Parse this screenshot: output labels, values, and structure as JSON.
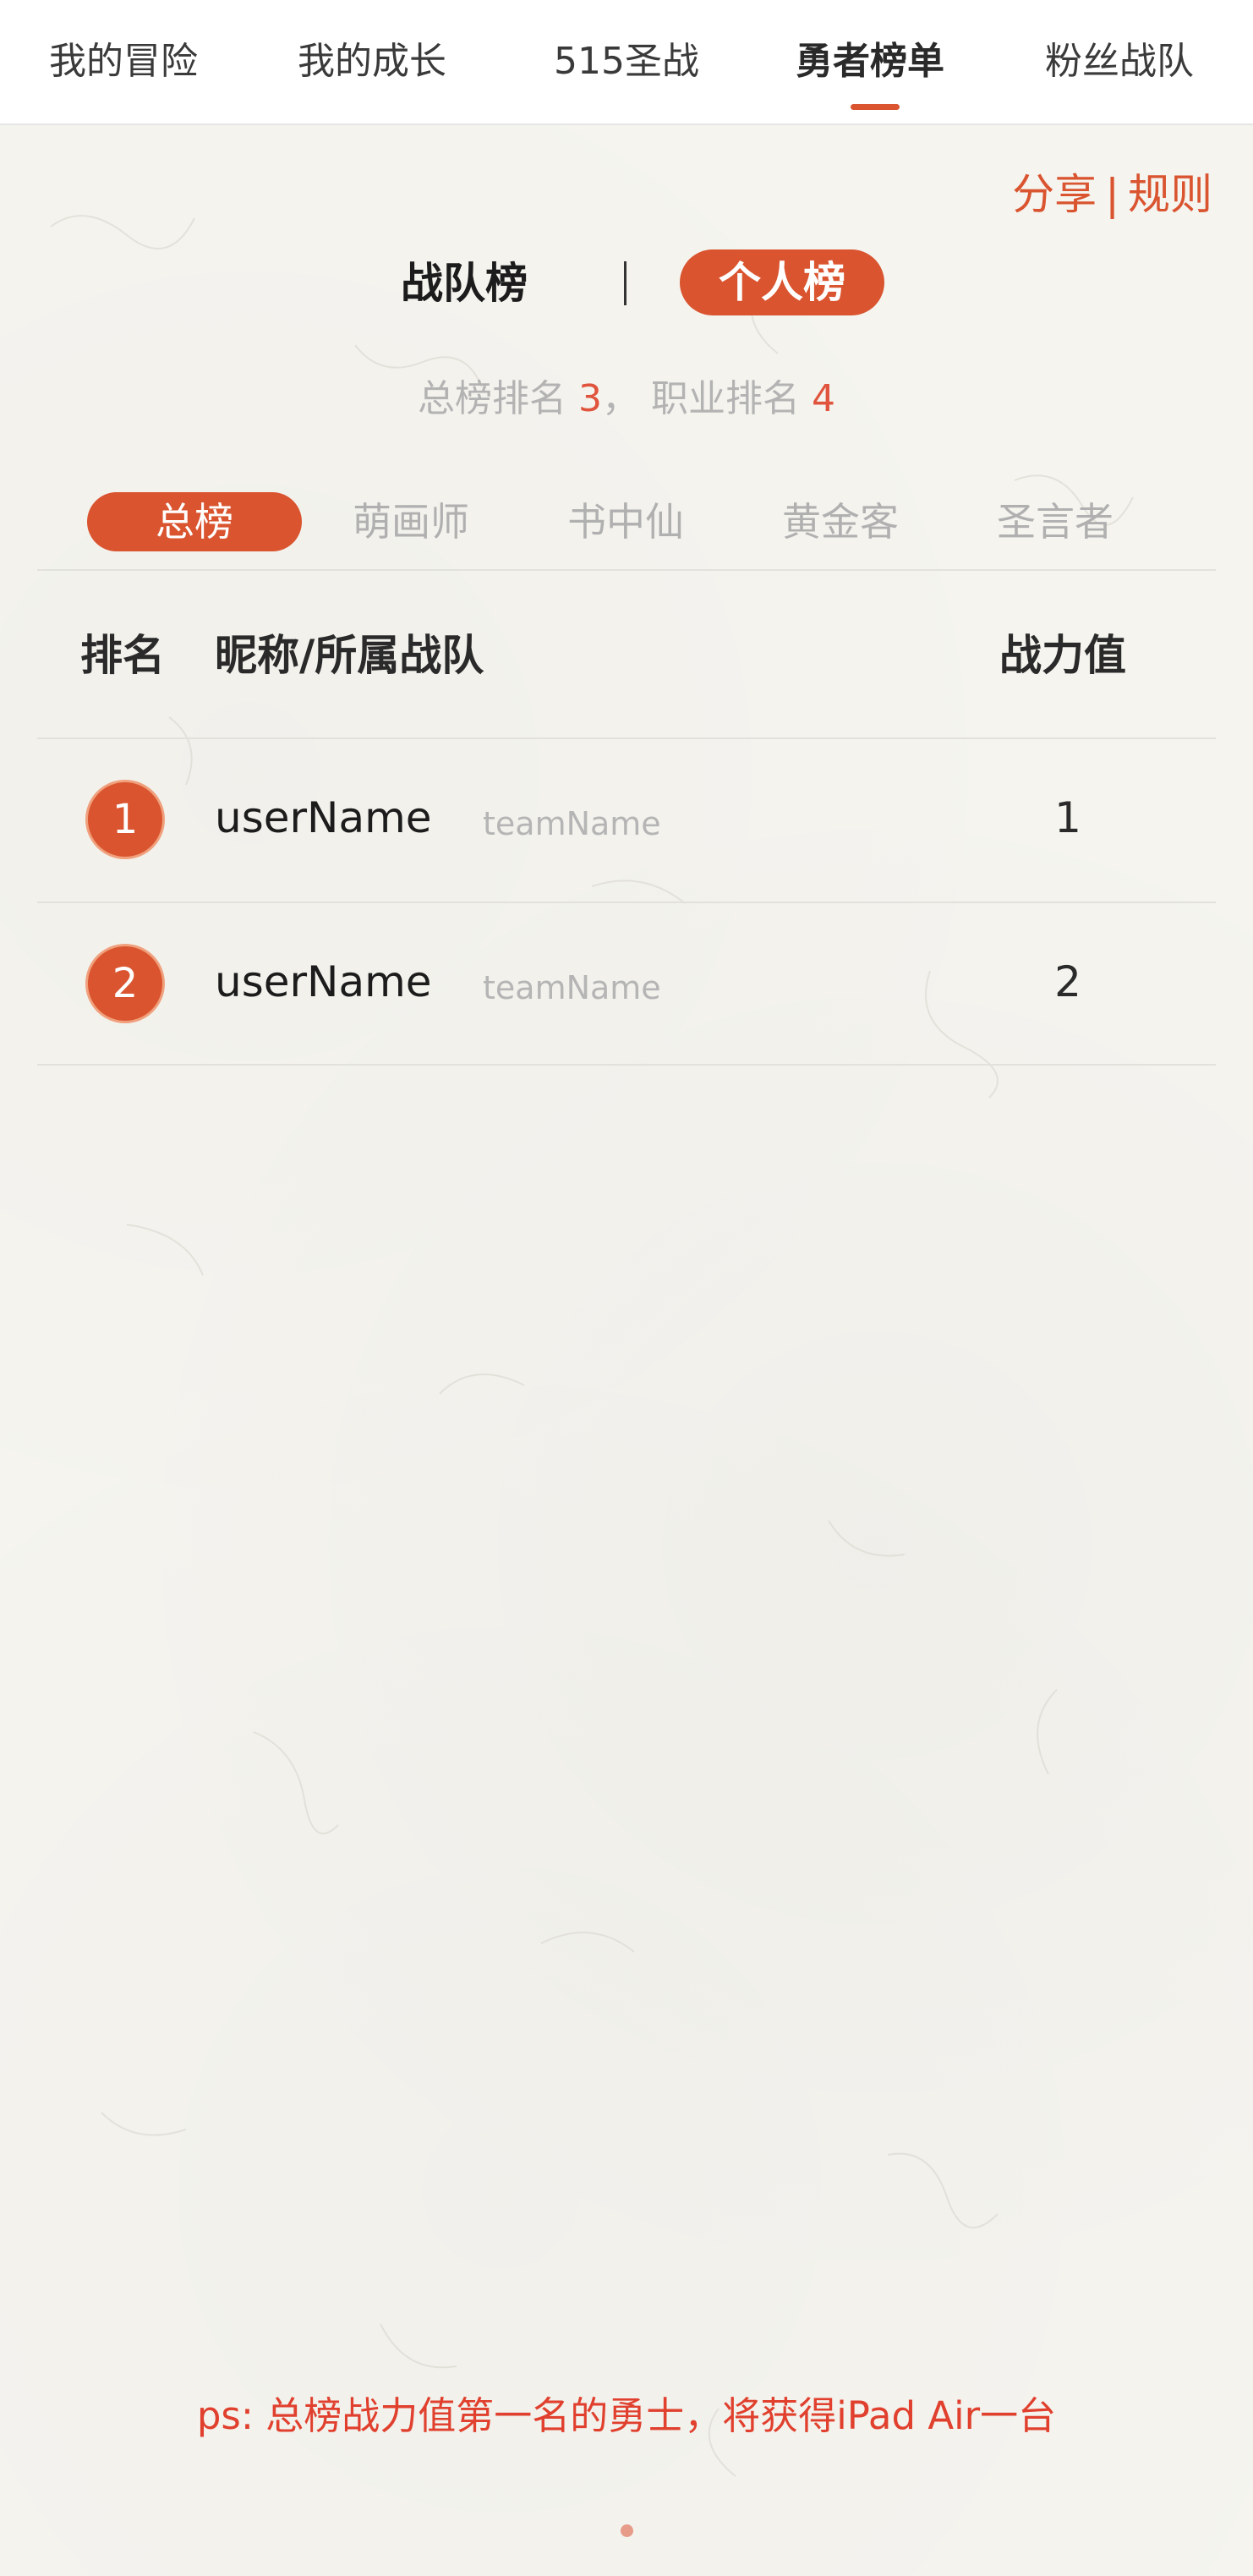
{
  "nav": {
    "items": [
      {
        "label": "我的冒险"
      },
      {
        "label": "我的成长"
      },
      {
        "label": "515圣战"
      },
      {
        "label": "勇者榜单",
        "active": true
      },
      {
        "label": "粉丝战队"
      }
    ]
  },
  "header_links": {
    "share": "分享",
    "separator": "|",
    "rules": "规则"
  },
  "board_toggle": {
    "team_board": "战队榜",
    "personal_board": "个人榜",
    "active": "personal_board"
  },
  "rank_summary": {
    "overall_label": "总榜排名",
    "overall_value": "3",
    "separator": "，",
    "class_label": "职业排名",
    "class_value": "4"
  },
  "categories": [
    {
      "label": "总榜",
      "active": true
    },
    {
      "label": "萌画师"
    },
    {
      "label": "书中仙"
    },
    {
      "label": "黄金客"
    },
    {
      "label": "圣言者"
    }
  ],
  "table": {
    "headers": {
      "rank": "排名",
      "name_team": "昵称/所属战队",
      "power": "战力值"
    },
    "rows": [
      {
        "rank": "1",
        "user_name": "userName",
        "team_name": "teamName",
        "power": "1"
      },
      {
        "rank": "2",
        "user_name": "userName",
        "team_name": "teamName",
        "power": "2"
      }
    ]
  },
  "footnote": "ps: 总榜战力值第一名的勇士，将获得iPad Air一台",
  "colors": {
    "accent": "#d9542f",
    "highlight_red": "#e0402d",
    "muted_text": "#b3b3b3",
    "background": "#f5f4ef"
  }
}
